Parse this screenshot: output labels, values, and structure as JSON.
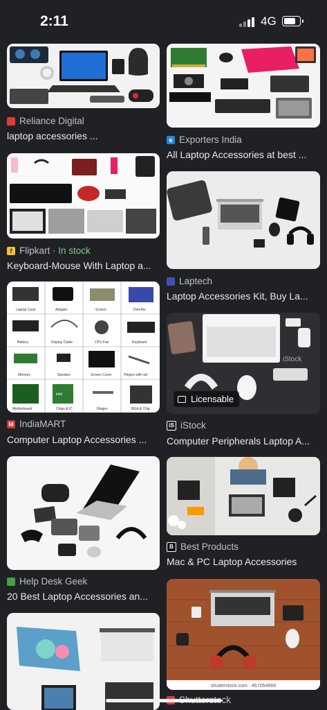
{
  "status": {
    "time": "2:11",
    "network": "4G"
  },
  "results": [
    {
      "source": "Reliance Digital",
      "title": "laptop accessories ...",
      "favicon_color": "#e53935"
    },
    {
      "source": "Exporters India",
      "title": "All Laptop Accessories at best ...",
      "favicon_color": "#1e88e5"
    },
    {
      "source": "Flipkart",
      "stock": "In stock",
      "title": "Keyboard-Mouse With Laptop a...",
      "favicon_color": "#fbc02d"
    },
    {
      "source": "Laptech",
      "title": "Laptop Accessories Kit, Buy La...",
      "favicon_color": "#3f51b5"
    },
    {
      "source": "IndiaMART",
      "title": "Computer Laptop Accessories ...",
      "favicon_color": "#d32f2f"
    },
    {
      "source": "iStock",
      "title": "Computer Peripherals Laptop A...",
      "favicon_color": "#202124",
      "badge": "Licensable"
    },
    {
      "source": "Help Desk Geek",
      "title": "20 Best Laptop Accessories an...",
      "favicon_color": "#43a047"
    },
    {
      "source": "Best Products",
      "title": "Mac & PC Laptop Accessories",
      "favicon_color": "#111111"
    },
    {
      "source": "Shutterstock",
      "title": "",
      "favicon_color": "#e53935"
    },
    {
      "source": "",
      "title": ""
    }
  ],
  "image_text": {
    "catalog_labels": [
      "Laptop Case",
      "Adapter",
      "Screen",
      "Dvd-Rw",
      "Battery",
      "Display Cable",
      "CPU Fan",
      "Keyboard",
      "Memory",
      "Speaker",
      "Screen Cover",
      "Hinges with rail",
      "Motherboard",
      "Chips & IC",
      "Hinges",
      "BGA & Chip"
    ],
    "istock_watermark": "iStock",
    "shutterstock_watermark": "shutterstock.com · 467054669",
    "chip_label": "intel"
  }
}
